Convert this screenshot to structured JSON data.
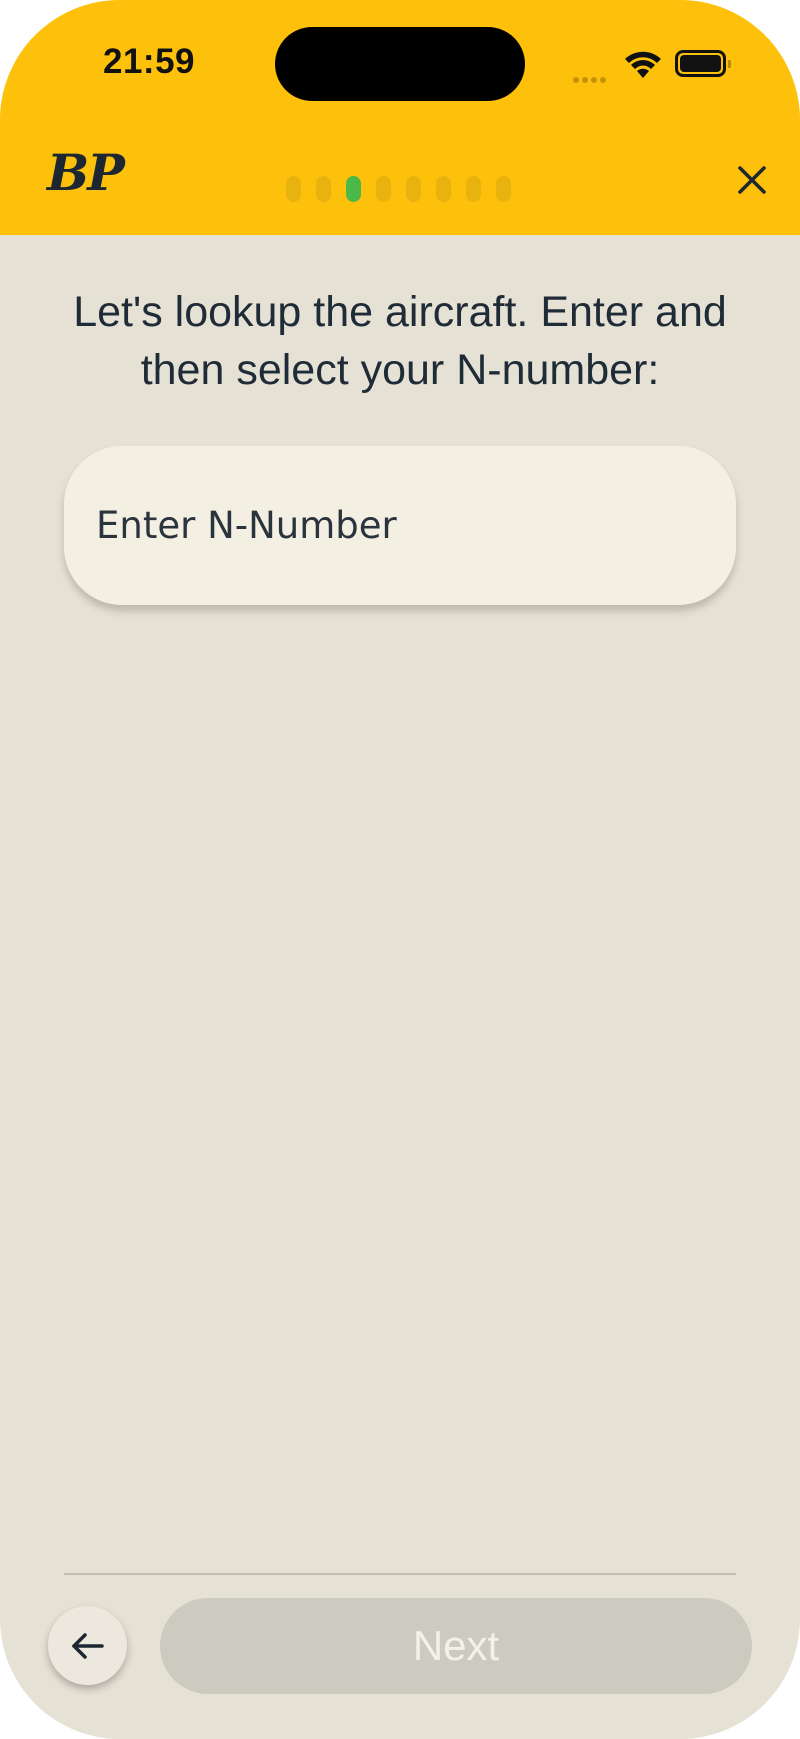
{
  "status_bar": {
    "time": "21:59"
  },
  "header": {
    "logo_text": "BP",
    "progress": {
      "total_steps": 8,
      "current_step": 3
    },
    "close_icon": "close-icon"
  },
  "main": {
    "prompt": "Let's lookup the aircraft. Enter and then select your N-number:",
    "n_number_input": {
      "value": "",
      "placeholder": "Enter N-Number"
    }
  },
  "footer": {
    "back_icon": "arrow-left-icon",
    "next_label": "Next"
  },
  "colors": {
    "header_bg": "#fdc10b",
    "page_bg": "#e5e1d5",
    "input_bg": "#f4efe3",
    "step_inactive": "#e8b20f",
    "step_active": "#4db84a",
    "next_disabled_bg": "#cccbbf"
  }
}
